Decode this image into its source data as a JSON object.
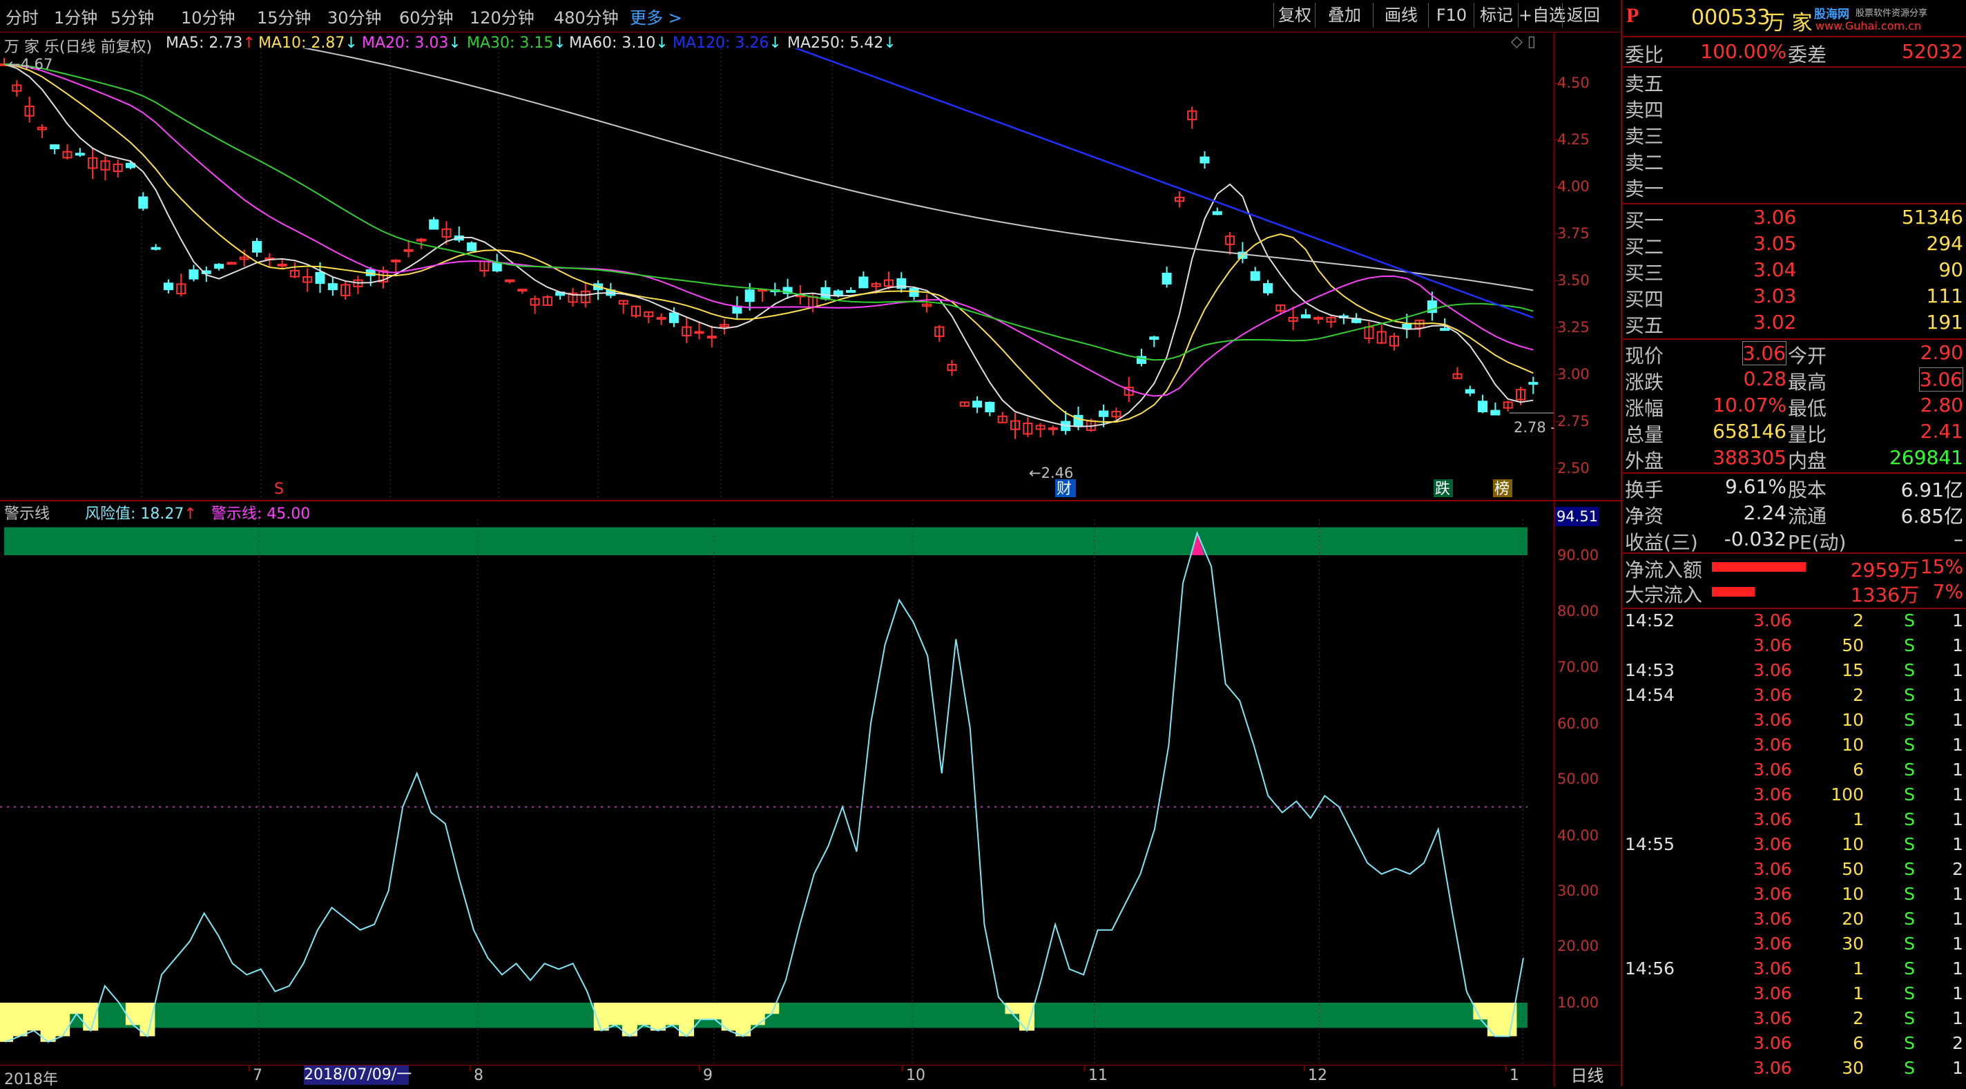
{
  "top_tabs": [
    "分时",
    "1分钟",
    "5分钟",
    "10分钟",
    "15分钟",
    "30分钟",
    "60分钟",
    "120分钟",
    "480分钟",
    "更多 >"
  ],
  "toolbar_buttons": [
    "复权",
    "叠加",
    "画线",
    "F10",
    "标记",
    "+自选",
    "返回"
  ],
  "chart_header": {
    "stock_period": "万 家 乐(日线 前复权)",
    "ma": [
      {
        "label": "MA5: 2.73",
        "arrow": "↑",
        "color": "#e0e0e0"
      },
      {
        "label": "MA10: 2.87",
        "arrow": "↓",
        "color": "#ffe04a"
      },
      {
        "label": "MA20: 3.03",
        "arrow": "↓",
        "color": "#ff40ff"
      },
      {
        "label": "MA30: 3.15",
        "arrow": "↓",
        "color": "#30d030"
      },
      {
        "label": "MA60: 3.10",
        "arrow": "↓",
        "color": "#e0e0e0"
      },
      {
        "label": "MA120: 3.26",
        "arrow": "↓",
        "color": "#2030ff"
      },
      {
        "label": "MA250: 5.42",
        "arrow": "↓",
        "color": "#e0e0e0"
      }
    ]
  },
  "price_axis": [
    "4.50",
    "4.25",
    "4.00",
    "3.75",
    "3.50",
    "3.25",
    "3.00",
    "2.75",
    "2.50"
  ],
  "price_marks": {
    "high": "4.67",
    "low": "2.46",
    "last": "2.78"
  },
  "chart_markers": {
    "s": "S",
    "cai": "财",
    "die": "跌",
    "bang": "榜"
  },
  "indicator_header": {
    "name": "警示线",
    "risk": "风险值: 18.27",
    "risk_arrow": "↑",
    "warn": "警示线: 45.00"
  },
  "indicator_axis": [
    "90.00",
    "80.00",
    "70.00",
    "60.00",
    "50.00",
    "40.00",
    "30.00",
    "20.00",
    "10.00"
  ],
  "indicator_top_value": "94.51",
  "x_axis": {
    "year": "2018年",
    "labels": [
      "7",
      "8",
      "9",
      "10",
      "11",
      "12",
      "1"
    ],
    "cursor_date": "2018/07/09/一",
    "period": "日线"
  },
  "colors": {
    "up": "#ff3030",
    "down": "#54ffff",
    "green_band": "#008040",
    "yellow_fill": "#ffff80",
    "risk_line": "#7ee8f8"
  },
  "chart_data": {
    "type": "line",
    "title": "",
    "series": [
      {
        "name": "风险值",
        "values": [
          3,
          4,
          5,
          3,
          4,
          8,
          5,
          13,
          10,
          6,
          4,
          15,
          18,
          21,
          26,
          22,
          17,
          15,
          16,
          12,
          13,
          17,
          23,
          27,
          25,
          23,
          24,
          30,
          45,
          51,
          44,
          42,
          32,
          23,
          18,
          15,
          17,
          14,
          17,
          16,
          17,
          12,
          5,
          6,
          4,
          6,
          5,
          6,
          4,
          7,
          7,
          5,
          4,
          6,
          8,
          14,
          24,
          33,
          38,
          45,
          37,
          60,
          74,
          82,
          78,
          72,
          51,
          75,
          59,
          24,
          11,
          8,
          5,
          14,
          24,
          16,
          15,
          23,
          23,
          28,
          33,
          41,
          56,
          85,
          94,
          88,
          67,
          64,
          56,
          47,
          44,
          46,
          43,
          47,
          45,
          40,
          35,
          33,
          34,
          33,
          35,
          41,
          26,
          12,
          7,
          4,
          4,
          18
        ]
      }
    ],
    "warning_line": 45.0,
    "ylim": [
      0,
      95
    ],
    "xlabel": "",
    "ylabel": ""
  },
  "right_panel": {
    "code": "000533",
    "name": "万 家",
    "logo_site": "股海网",
    "logo_sub": "股票软件资源分享",
    "logo_url": "www.Guhai.com.cn",
    "weibi_label": "委比",
    "weibi": "100.00%",
    "weicha_label": "委差",
    "weicha": "52032",
    "sell": [
      {
        "label": "卖五"
      },
      {
        "label": "卖四"
      },
      {
        "label": "卖三"
      },
      {
        "label": "卖二"
      },
      {
        "label": "卖一"
      }
    ],
    "buy": [
      {
        "label": "买一",
        "price": "3.06",
        "vol": "51346"
      },
      {
        "label": "买二",
        "price": "3.05",
        "vol": "294"
      },
      {
        "label": "买三",
        "price": "3.04",
        "vol": "90"
      },
      {
        "label": "买四",
        "price": "3.03",
        "vol": "111"
      },
      {
        "label": "买五",
        "price": "3.02",
        "vol": "191"
      }
    ],
    "stats": [
      {
        "l1": "现价",
        "v1": "3.06",
        "l2": "今开",
        "v2": "2.90"
      },
      {
        "l1": "涨跌",
        "v1": "0.28",
        "l2": "最高",
        "v2": "3.06"
      },
      {
        "l1": "涨幅",
        "v1": "10.07%",
        "l2": "最低",
        "v2": "2.80"
      },
      {
        "l1": "总量",
        "v1": "658146",
        "l2": "量比",
        "v2": "2.41"
      },
      {
        "l1": "外盘",
        "v1": "388305",
        "l2": "内盘",
        "v2": "269841"
      }
    ],
    "stats2": [
      {
        "l1": "换手",
        "v1": "9.61%",
        "l2": "股本",
        "v2": "6.91亿"
      },
      {
        "l1": "净资",
        "v1": "2.24",
        "l2": "流通",
        "v2": "6.85亿"
      },
      {
        "l1": "收益(三)",
        "v1": "-0.032",
        "l2": "PE(动)",
        "v2": "–"
      }
    ],
    "flow": [
      {
        "label": "净流入额",
        "value": "2959万",
        "pct": "15%",
        "bar": 0.62
      },
      {
        "label": "大宗流入",
        "value": "1336万",
        "pct": "7%",
        "bar": 0.28
      }
    ],
    "ticks": [
      {
        "time": "14:52",
        "price": "3.06",
        "vol": "2",
        "dir": "S",
        "n": "1"
      },
      {
        "time": "",
        "price": "3.06",
        "vol": "50",
        "dir": "S",
        "n": "1"
      },
      {
        "time": "14:53",
        "price": "3.06",
        "vol": "15",
        "dir": "S",
        "n": "1"
      },
      {
        "time": "14:54",
        "price": "3.06",
        "vol": "2",
        "dir": "S",
        "n": "1"
      },
      {
        "time": "",
        "price": "3.06",
        "vol": "10",
        "dir": "S",
        "n": "1"
      },
      {
        "time": "",
        "price": "3.06",
        "vol": "10",
        "dir": "S",
        "n": "1"
      },
      {
        "time": "",
        "price": "3.06",
        "vol": "6",
        "dir": "S",
        "n": "1"
      },
      {
        "time": "",
        "price": "3.06",
        "vol": "100",
        "dir": "S",
        "n": "1"
      },
      {
        "time": "",
        "price": "3.06",
        "vol": "1",
        "dir": "S",
        "n": "1"
      },
      {
        "time": "14:55",
        "price": "3.06",
        "vol": "10",
        "dir": "S",
        "n": "1"
      },
      {
        "time": "",
        "price": "3.06",
        "vol": "50",
        "dir": "S",
        "n": "2"
      },
      {
        "time": "",
        "price": "3.06",
        "vol": "10",
        "dir": "S",
        "n": "1"
      },
      {
        "time": "",
        "price": "3.06",
        "vol": "20",
        "dir": "S",
        "n": "1"
      },
      {
        "time": "",
        "price": "3.06",
        "vol": "30",
        "dir": "S",
        "n": "1"
      },
      {
        "time": "14:56",
        "price": "3.06",
        "vol": "1",
        "dir": "S",
        "n": "1"
      },
      {
        "time": "",
        "price": "3.06",
        "vol": "1",
        "dir": "S",
        "n": "1"
      },
      {
        "time": "",
        "price": "3.06",
        "vol": "2",
        "dir": "S",
        "n": "1"
      },
      {
        "time": "",
        "price": "3.06",
        "vol": "6",
        "dir": "S",
        "n": "2"
      },
      {
        "time": "",
        "price": "3.06",
        "vol": "30",
        "dir": "S",
        "n": "1"
      }
    ]
  }
}
